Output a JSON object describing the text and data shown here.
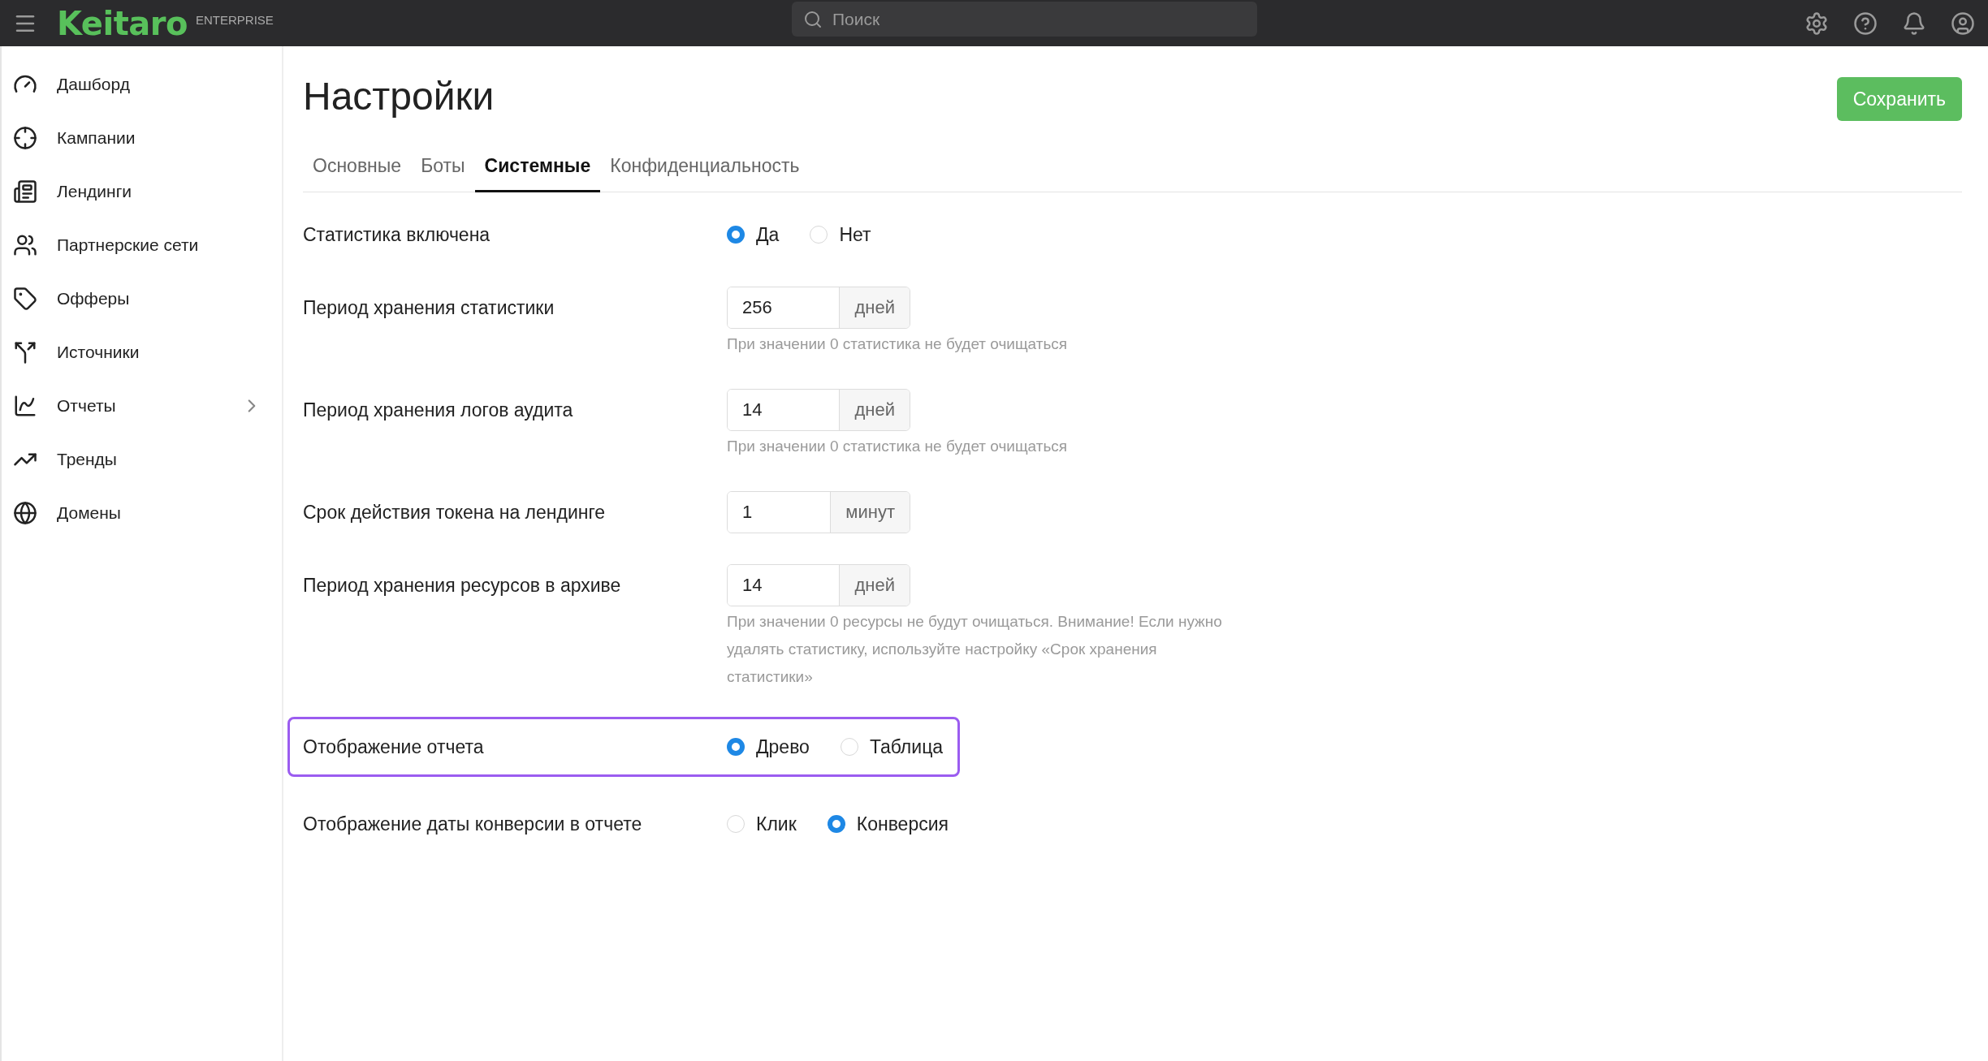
{
  "topbar": {
    "logo": "Keitaro",
    "edition": "ENTERPRISE",
    "search": {
      "placeholder": "Поиск"
    }
  },
  "sidebar": {
    "items": [
      {
        "label": "Дашборд",
        "has_submenu": false
      },
      {
        "label": "Кампании",
        "has_submenu": false
      },
      {
        "label": "Лендинги",
        "has_submenu": false
      },
      {
        "label": "Партнерские сети",
        "has_submenu": false
      },
      {
        "label": "Офферы",
        "has_submenu": false
      },
      {
        "label": "Источники",
        "has_submenu": false
      },
      {
        "label": "Отчеты",
        "has_submenu": true
      },
      {
        "label": "Тренды",
        "has_submenu": false
      },
      {
        "label": "Домены",
        "has_submenu": false
      }
    ]
  },
  "page": {
    "title": "Настройки",
    "save_button": "Сохранить"
  },
  "tabs": [
    {
      "label": "Основные",
      "selected": false
    },
    {
      "label": "Боты",
      "selected": false
    },
    {
      "label": "Системные",
      "selected": true
    },
    {
      "label": "Конфиденциальность",
      "selected": false
    }
  ],
  "fields": [
    {
      "kind": "radio",
      "label": "Статистика включена",
      "highlighted": false,
      "options": [
        {
          "label": "Да",
          "selected": true
        },
        {
          "label": "Нет",
          "selected": false
        }
      ]
    },
    {
      "kind": "number",
      "label": "Период хранения статистики",
      "highlighted": false,
      "value": "256",
      "unit": "дней",
      "hint": "При значении 0 статистика не будет очищаться"
    },
    {
      "kind": "number",
      "label": "Период хранения логов аудита",
      "highlighted": false,
      "value": "14",
      "unit": "дней",
      "hint": "При значении 0 статистика не будет очищаться"
    },
    {
      "kind": "number",
      "label": "Срок действия токена на лендинге",
      "highlighted": false,
      "value": "1",
      "unit": "минут"
    },
    {
      "kind": "number",
      "label": "Период хранения ресурсов в архиве",
      "highlighted": false,
      "value": "14",
      "unit": "дней",
      "hint": "При значении 0 ресурсы не будут очищаться. Внимание! Если нужно удалять статистику, используйте настройку «Срок хранения статистики»"
    },
    {
      "kind": "radio",
      "label": "Отображение отчета",
      "highlighted": true,
      "options": [
        {
          "label": "Древо",
          "selected": true
        },
        {
          "label": "Таблица",
          "selected": false
        }
      ]
    },
    {
      "kind": "radio",
      "label": "Отображение даты конверсии в отчете",
      "highlighted": false,
      "options": [
        {
          "label": "Клик",
          "selected": false
        },
        {
          "label": "Конверсия",
          "selected": true
        }
      ]
    }
  ]
}
